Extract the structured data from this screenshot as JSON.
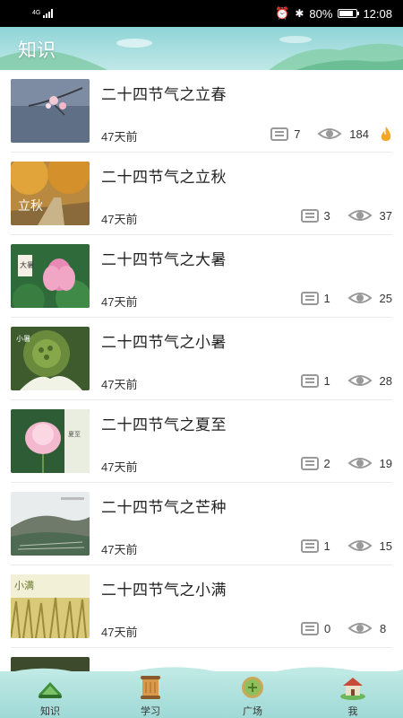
{
  "status_bar": {
    "network": "4G",
    "battery": "80%",
    "time": "12:08"
  },
  "header": {
    "title": "知识"
  },
  "articles": [
    {
      "title": "二十四节气之立春",
      "date": "47天前",
      "comments": "7",
      "views": "184",
      "hot": true,
      "thumb_text": ""
    },
    {
      "title": "二十四节气之立秋",
      "date": "47天前",
      "comments": "3",
      "views": "37",
      "hot": false,
      "thumb_text": "立秋"
    },
    {
      "title": "二十四节气之大暑",
      "date": "47天前",
      "comments": "1",
      "views": "25",
      "hot": false,
      "thumb_text": "大暑"
    },
    {
      "title": "二十四节气之小暑",
      "date": "47天前",
      "comments": "1",
      "views": "28",
      "hot": false,
      "thumb_text": "小暑"
    },
    {
      "title": "二十四节气之夏至",
      "date": "47天前",
      "comments": "2",
      "views": "19",
      "hot": false,
      "thumb_text": "夏至"
    },
    {
      "title": "二十四节气之芒种",
      "date": "47天前",
      "comments": "1",
      "views": "15",
      "hot": false,
      "thumb_text": ""
    },
    {
      "title": "二十四节气之小满",
      "date": "47天前",
      "comments": "0",
      "views": "8",
      "hot": false,
      "thumb_text": "小满"
    }
  ],
  "tabbar": {
    "tabs": [
      {
        "label": "知识",
        "icon": "knowledge-icon",
        "active": true
      },
      {
        "label": "学习",
        "icon": "scroll-icon",
        "active": false
      },
      {
        "label": "广场",
        "icon": "plaza-icon",
        "active": false
      },
      {
        "label": "我",
        "icon": "house-icon",
        "active": false
      }
    ]
  },
  "colors": {
    "header_top": "#8fd4d8",
    "header_bottom": "#bfe8e6",
    "tabbar": "#aee0dc",
    "fire": "#f5a623",
    "icon_gray": "#999999"
  }
}
